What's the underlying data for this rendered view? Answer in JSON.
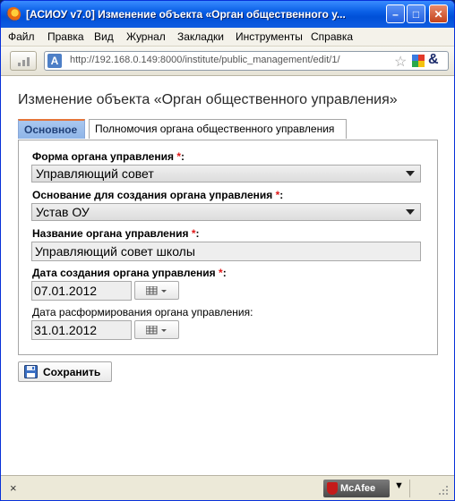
{
  "window": {
    "title": "[АСИОУ v7.0] Изменение объекта «Орган общественного у..."
  },
  "menu": {
    "items": [
      {
        "label": "Файл"
      },
      {
        "label": "Правка"
      },
      {
        "label": "Вид"
      },
      {
        "label": "Журнал"
      },
      {
        "label": "Закладки"
      },
      {
        "label": "Инструменты"
      },
      {
        "label": "Справка"
      }
    ]
  },
  "nav": {
    "url_badge": "A",
    "url": "http://192.168.0.149:8000/institute/public_management/edit/1/"
  },
  "page": {
    "title": "Изменение объекта «Орган общественного управления»",
    "tabs": [
      {
        "label": "Основное",
        "active": true
      },
      {
        "label": "Полномочия органа общественного управления",
        "active": false
      }
    ],
    "fields": {
      "form": {
        "label": "Форма органа управления",
        "required_mark": "*",
        "suffix": ":",
        "value": "Управляющий совет"
      },
      "basis": {
        "label": "Основание для создания органа управления",
        "required_mark": "*",
        "suffix": ":",
        "value": "Устав ОУ"
      },
      "name": {
        "label": "Название органа управления",
        "required_mark": "*",
        "suffix": ":",
        "value": "Управляющий совет школы"
      },
      "created": {
        "label": "Дата создания органа управления",
        "required_mark": "*",
        "suffix": ":",
        "value": "07.01.2012"
      },
      "dissolved": {
        "label": "Дата расформирования органа управления:",
        "value": "31.01.2012"
      }
    },
    "save_label": "Сохранить"
  },
  "status": {
    "close_glyph": "×",
    "addon_name": "McAfee",
    "dropdown_glyph": "▼"
  },
  "colors": {
    "titlebar": "#0a5fe6",
    "tab_active": "#a9c7ef",
    "required": "#e01818"
  }
}
